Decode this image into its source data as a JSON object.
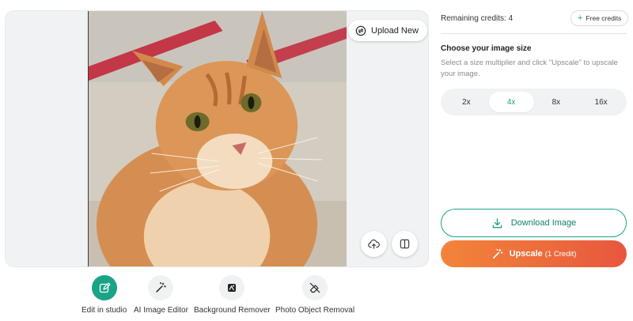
{
  "preview": {
    "upload_new_label": "Upload New",
    "upload_cloud_icon": "cloud-upload-icon",
    "compare_icon": "compare-split-icon"
  },
  "tools": [
    {
      "label": "Edit in studio",
      "icon": "edit-studio-icon",
      "active": true
    },
    {
      "label": "AI Image Editor",
      "icon": "magic-wand-icon",
      "active": false
    },
    {
      "label": "Background Remover",
      "icon": "background-remover-icon",
      "active": false
    },
    {
      "label": "Photo Object Removal",
      "icon": "eraser-icon",
      "active": false
    }
  ],
  "sidebar": {
    "credits_text": "Remaining credits: 4",
    "free_credits_label": "Free credits",
    "size_title": "Choose your image size",
    "size_desc": "Select a size multiplier and click \"Upscale\" to upscale your image.",
    "sizes": [
      "2x",
      "4x",
      "8x",
      "16x"
    ],
    "selected_size": "4x",
    "download_label": "Download Image",
    "upscale_label": "Upscale",
    "upscale_sub": "(1 Credit)"
  },
  "colors": {
    "accent_green": "#1aa386",
    "upscale_gradient_start": "#f2843a",
    "upscale_gradient_end": "#e8563f"
  }
}
